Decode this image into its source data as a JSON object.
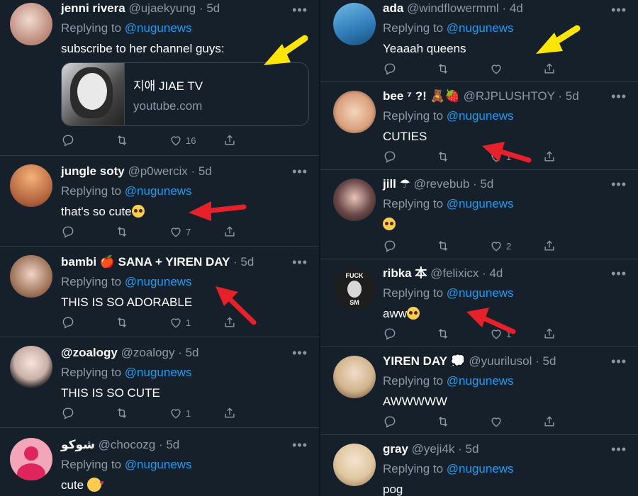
{
  "left": [
    {
      "name": "jenni rivera",
      "handle": "@ujaekyung",
      "time": "5d",
      "reply_prefix": "Replying to",
      "mention": "@nugunews",
      "text": "subscribe to her channel guys:",
      "card": {
        "title": "지애 JIAE TV",
        "domain": "youtube.com"
      },
      "likes": "16",
      "avatar": "#c9a39a"
    },
    {
      "name": "jungle soty",
      "handle": "@p0wercix",
      "time": "5d",
      "reply_prefix": "Replying to",
      "mention": "@nugunews",
      "text": "that's so cute",
      "emoji": "pleading",
      "likes": "7",
      "avatar": "#d88a58"
    },
    {
      "name": "bambi 🍎 SANA + YIREN DAY",
      "handle": "",
      "time": "5d",
      "reply_prefix": "Replying to",
      "mention": "@nugunews",
      "text": "THIS IS SO ADORABLE",
      "likes": "1",
      "avatar": "#8a6a55"
    },
    {
      "name": "@zoalogy",
      "handle": "@zoalogy",
      "time": "5d",
      "reply_prefix": "Replying to",
      "mention": "@nugunews",
      "text": "THIS IS SO CUTE",
      "likes": "1",
      "avatar": "#e8e8e8"
    },
    {
      "name": "شوكو",
      "handle": "@chocozg",
      "time": "5d",
      "reply_prefix": "Replying to",
      "mention": "@nugunews",
      "text": "cute",
      "emoji": "hearts",
      "avatar": "#f3a6b8"
    }
  ],
  "right": [
    {
      "name": "ada",
      "handle": "@windflowermml",
      "time": "4d",
      "reply_prefix": "Replying to",
      "mention": "@nugunews",
      "text": "Yeaaah queens",
      "avatar": "#4a90c2"
    },
    {
      "name": "bee ⁷ ?! 🧸🍓",
      "handle": "@RJPLUSHTOY",
      "time": "5d",
      "reply_prefix": "Replying to",
      "mention": "@nugunews",
      "text": "CUTIES",
      "likes": "1",
      "avatar": "#e6c1a8"
    },
    {
      "name": "jill ☂",
      "handle": "@revebub",
      "time": "5d",
      "reply_prefix": "Replying to",
      "mention": "@nugunews",
      "text": "",
      "emoji": "pleading",
      "likes": "2",
      "avatar": "#3a2a2a"
    },
    {
      "name": "ribka 本",
      "handle": "@felixicx",
      "time": "4d",
      "reply_prefix": "Replying to",
      "mention": "@nugunews",
      "text": "aww",
      "emoji": "pleading",
      "likes": "1",
      "avatar": "#222222",
      "avatar_text_top": "FUCK",
      "avatar_text_bottom": "SM"
    },
    {
      "name": "YIREN DAY 💭",
      "handle": "@yuurilusol",
      "time": "5d",
      "reply_prefix": "Replying to",
      "mention": "@nugunews",
      "text": "AWWWWW",
      "avatar": "#d9c2a0"
    },
    {
      "name": "gray",
      "handle": "@yeji4k",
      "time": "5d",
      "reply_prefix": "Replying to",
      "mention": "@nugunews",
      "text": "pog",
      "avatar": "#e0c7a0"
    }
  ],
  "icons": {
    "reply": "reply-icon",
    "retweet": "retweet-icon",
    "like": "heart-icon",
    "share": "share-icon",
    "more": "more-icon"
  },
  "colors": {
    "background": "#15202b",
    "mention": "#1d9bf0",
    "muted": "#8b98a5",
    "arrow_red": "#e8202a",
    "arrow_yellow": "#ffe600"
  }
}
